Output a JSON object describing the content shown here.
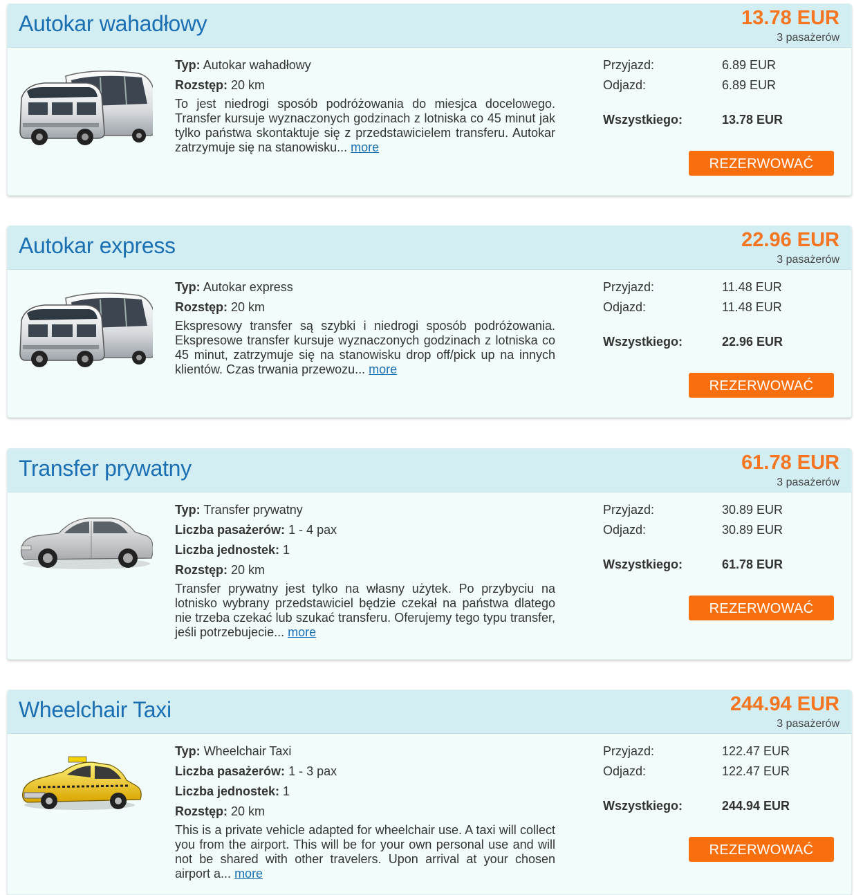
{
  "labels": {
    "type": "Typ:",
    "passengers": "Liczba pasażerów:",
    "units": "Liczba jednostek:",
    "distance": "Rozstęp:",
    "arrival": "Przyjazd:",
    "departure": "Odjazd:",
    "total": "Wszystkiego:",
    "book": "REZERWOWAĆ",
    "more": "more"
  },
  "offers": [
    {
      "title": "Autokar wahadłowy",
      "price": "13.78 EUR",
      "passenger_count": "3 pasażerów",
      "icon": "shuttle-bus-icon",
      "type": "Autokar wahadłowy",
      "distance": "20 km",
      "description": "To jest niedrogi sposób podróżowania do miesjca docelowego. Transfer kursuje wyznaczonych godzinach z lotniska co 45 minut jak tylko państwa skontaktuje się z przedstawicielem transferu. Autokar zatrzymuje się na stanowisku...",
      "arrival": "6.89 EUR",
      "departure": "6.89 EUR",
      "total": "13.78 EUR"
    },
    {
      "title": "Autokar express",
      "price": "22.96 EUR",
      "passenger_count": "3 pasażerów",
      "icon": "shuttle-bus-icon",
      "type": "Autokar express",
      "distance": "20 km",
      "description": "Ekspresowy transfer są szybki i niedrogi sposób podróżowania. Ekspresowe transfer kursuje wyznaczonych godzinach z lotniska co 45 minut, zatrzymuje się na stanowisku drop off/pick up na innych klientów. Czas trwania przewozu...",
      "arrival": "11.48 EUR",
      "departure": "11.48 EUR",
      "total": "22.96 EUR"
    },
    {
      "title": "Transfer prywatny",
      "price": "61.78 EUR",
      "passenger_count": "3 pasażerów",
      "icon": "sedan-car-icon",
      "type": "Transfer prywatny",
      "passengers": "1 - 4 pax",
      "units": "1",
      "distance": "20 km",
      "description": "Transfer prywatny jest tylko na własny użytek. Po przybyciu na lotnisko wybrany przedstawiciel będzie czekał na państwa dlatego nie trzeba czekać lub szukać transferu. Oferujemy tego typu transfer, jeśli potrzebujecie...",
      "arrival": "30.89 EUR",
      "departure": "30.89 EUR",
      "total": "61.78 EUR"
    },
    {
      "title": "Wheelchair Taxi",
      "price": "244.94 EUR",
      "passenger_count": "3 pasażerów",
      "icon": "taxi-cab-icon",
      "type": "Wheelchair Taxi",
      "passengers": "1 - 3 pax",
      "units": "1",
      "distance": "20 km",
      "description": "This is a private vehicle adapted for wheelchair use. A taxi will collect you from the airport. This will be for your own personal use and will not be shared with other travelers. Upon arrival at your chosen airport a...",
      "arrival": "122.47 EUR",
      "departure": "122.47 EUR",
      "total": "244.94 EUR"
    }
  ]
}
